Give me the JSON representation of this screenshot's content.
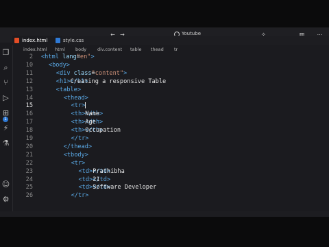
{
  "window": {
    "search_label": "Youtube"
  },
  "titlebar_icons": [
    "back-arrow-icon",
    "forward-arrow-icon",
    "search-icon",
    "copilot-icon",
    "split-editor-icon",
    "more-icon"
  ],
  "activity_bar": {
    "icons": [
      "files-icon",
      "search-icon",
      "source-control-icon",
      "run-debug-icon",
      "extensions-icon",
      "remote-icon",
      "account-icon",
      "settings-icon"
    ],
    "badge": "1"
  },
  "tabs": [
    {
      "label": "index.html",
      "active": true
    },
    {
      "label": "style.css",
      "active": false
    }
  ],
  "breadcrumb": [
    "index.html",
    "html",
    "body",
    "div.content",
    "table",
    "thead",
    "tr"
  ],
  "code_lines": [
    {
      "n": "2",
      "indent": 0,
      "parts": [
        [
          "tag",
          "<html "
        ],
        [
          "attr",
          "lang"
        ],
        [
          "txt",
          "="
        ],
        [
          "str",
          "\"en\""
        ],
        [
          "tag",
          ">"
        ]
      ]
    },
    {
      "n": "10",
      "indent": 1,
      "parts": [
        [
          "tag",
          "<body>"
        ]
      ]
    },
    {
      "n": "11",
      "indent": 2,
      "parts": [
        [
          "tag",
          "<div "
        ],
        [
          "attr",
          "class"
        ],
        [
          "txt",
          "="
        ],
        [
          "str",
          "\"content\""
        ],
        [
          "tag",
          ">"
        ]
      ]
    },
    {
      "n": "12",
      "indent": 2,
      "parts": [
        [
          "tag",
          "<h1>"
        ],
        [
          "txt",
          "Creating a responsive Table"
        ],
        [
          "tag",
          "</h1>"
        ]
      ]
    },
    {
      "n": "13",
      "indent": 2,
      "parts": [
        [
          "tag",
          "<table>"
        ]
      ]
    },
    {
      "n": "14",
      "indent": 3,
      "parts": [
        [
          "tag",
          "<thead>"
        ]
      ]
    },
    {
      "n": "15",
      "indent": 4,
      "parts": [
        [
          "tag",
          "<tr>"
        ]
      ],
      "current": true
    },
    {
      "n": "16",
      "indent": 4,
      "parts": [
        [
          "tag",
          "<th>"
        ],
        [
          "txt",
          "Name"
        ],
        [
          "tag",
          "</th>"
        ]
      ]
    },
    {
      "n": "17",
      "indent": 4,
      "parts": [
        [
          "tag",
          "<th>"
        ],
        [
          "txt",
          "Age"
        ],
        [
          "tag",
          "</th>"
        ]
      ]
    },
    {
      "n": "18",
      "indent": 4,
      "parts": [
        [
          "tag",
          "<th>"
        ],
        [
          "txt",
          "Occupation"
        ],
        [
          "tag",
          "</th>"
        ]
      ]
    },
    {
      "n": "19",
      "indent": 4,
      "parts": [
        [
          "tag",
          "</tr>"
        ]
      ]
    },
    {
      "n": "20",
      "indent": 3,
      "parts": [
        [
          "tag",
          "</thead>"
        ]
      ]
    },
    {
      "n": "21",
      "indent": 3,
      "parts": [
        [
          "tag",
          "<tbody>"
        ]
      ]
    },
    {
      "n": "22",
      "indent": 4,
      "parts": [
        [
          "tag",
          "<tr>"
        ]
      ]
    },
    {
      "n": "23",
      "indent": 5,
      "parts": [
        [
          "tag",
          "<td>"
        ],
        [
          "txt",
          "Prathibha"
        ],
        [
          "tag",
          "</td>"
        ]
      ]
    },
    {
      "n": "24",
      "indent": 5,
      "parts": [
        [
          "tag",
          "<td>"
        ],
        [
          "txt",
          "21"
        ],
        [
          "tag",
          "</td>"
        ]
      ]
    },
    {
      "n": "25",
      "indent": 5,
      "parts": [
        [
          "tag",
          "<td>"
        ],
        [
          "txt",
          "Software Developer"
        ],
        [
          "tag",
          "</td>"
        ]
      ]
    },
    {
      "n": "26",
      "indent": 4,
      "parts": [
        [
          "tag",
          "</tr>"
        ]
      ]
    }
  ],
  "colors": {
    "tag": "#5aa9e6",
    "attr": "#9cdcfe",
    "string": "#ce9178",
    "text": "#e6e6e6",
    "html_file": "#e44d26",
    "css_file": "#2f7ad6"
  }
}
